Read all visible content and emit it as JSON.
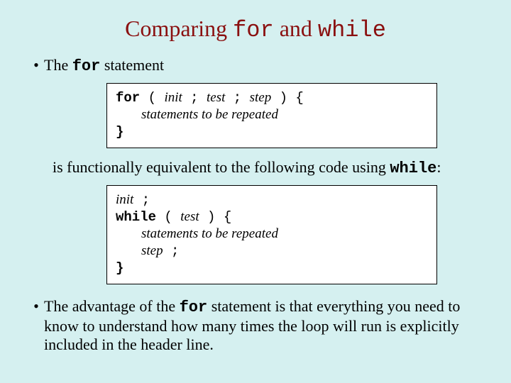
{
  "title": {
    "p1": "Comparing ",
    "kw1": "for",
    "p2": " and ",
    "kw2": "while"
  },
  "bullet1": {
    "p1": "The ",
    "kw": "for",
    "p2": " statement"
  },
  "code1": {
    "l1_kw": "for",
    "l1_a": " ( ",
    "l1_init": "init",
    "l1_b": " ; ",
    "l1_test": "test",
    "l1_c": " ; ",
    "l1_step": "step",
    "l1_d": " ) {",
    "l2": "statements to be repeated",
    "l3": "}"
  },
  "mid": {
    "p1": "is functionally equivalent to the following code using ",
    "kw": "while",
    "p2": ":"
  },
  "code2": {
    "l1_init": "init",
    "l1_b": " ;",
    "l2_kw": "while",
    "l2_a": " ( ",
    "l2_test": "test",
    "l2_b": " ) {",
    "l3": "statements to be repeated",
    "l4_step": "step",
    "l4_b": " ;",
    "l5": "}"
  },
  "bullet2": {
    "p1": "The advantage of the ",
    "kw": "for",
    "p2": " statement is that everything you need to know to understand how many times the loop will run is explicitly included in the header line."
  }
}
